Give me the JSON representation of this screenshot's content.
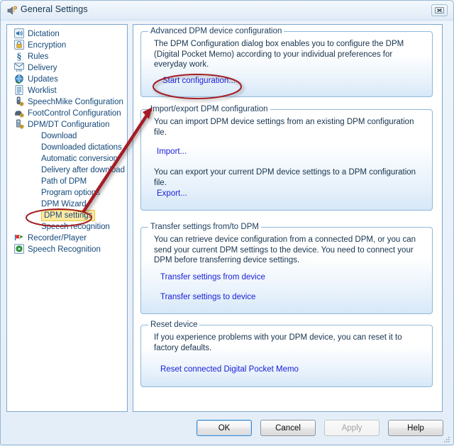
{
  "window": {
    "title": "General Settings",
    "title_icon": "speaker-settings-icon",
    "close_label": "Close"
  },
  "sidebar": {
    "items": [
      {
        "label": "Dictation",
        "icon": "dictation-icon",
        "level": 0
      },
      {
        "label": "Encryption",
        "icon": "lock-icon",
        "level": 0
      },
      {
        "label": "Rules",
        "icon": "section-sign-icon",
        "level": 0
      },
      {
        "label": "Delivery",
        "icon": "ftp-envelope-icon",
        "level": 0
      },
      {
        "label": "Updates",
        "icon": "globe-refresh-icon",
        "level": 0
      },
      {
        "label": "Worklist",
        "icon": "list-icon",
        "level": 0
      },
      {
        "label": "SpeechMike Configuration",
        "icon": "speechmike-icon",
        "level": 0
      },
      {
        "label": "FootControl Configuration",
        "icon": "footcontrol-icon",
        "level": 0
      },
      {
        "label": "DPM/DT Configuration",
        "icon": "dpm-device-icon",
        "level": 0
      },
      {
        "label": "Download",
        "icon": "",
        "level": 1
      },
      {
        "label": "Downloaded dictations",
        "icon": "",
        "level": 1
      },
      {
        "label": "Automatic conversion",
        "icon": "",
        "level": 1
      },
      {
        "label": "Delivery after download",
        "icon": "",
        "level": 1
      },
      {
        "label": "Path of DPM",
        "icon": "",
        "level": 1
      },
      {
        "label": "Program options",
        "icon": "",
        "level": 1
      },
      {
        "label": "DPM Wizard",
        "icon": "",
        "level": 1
      },
      {
        "label": "DPM settings",
        "icon": "",
        "level": 1,
        "highlighted": true
      },
      {
        "label": "Speech recognition",
        "icon": "",
        "level": 1
      },
      {
        "label": "Recorder/Player",
        "icon": "play-flag-icon",
        "level": 0
      },
      {
        "label": "Speech Recognition",
        "icon": "green-gear-icon",
        "level": 0
      }
    ]
  },
  "main": {
    "groups": [
      {
        "title": "Advanced DPM device configuration",
        "text": "The DPM Configuration dialog box enables you to configure the DPM (Digital Pocket Memo) according to your individual preferences for everyday work.",
        "links": [
          "Start configuration..."
        ]
      },
      {
        "title": "Import/export DPM configuration",
        "text": "You can import DPM device settings from an existing DPM configuration file.",
        "text2": "You can export your current DPM device settings to a DPM configuration file.",
        "links": [
          "Import...",
          "Export..."
        ]
      },
      {
        "title": "Transfer settings from/to DPM",
        "text": "You can retrieve device configuration from a connected DPM, or you can send your current DPM settings to the device. You need to connect your DPM before transferring device settings.",
        "links": [
          "Transfer settings from device",
          "Transfer settings to device"
        ]
      },
      {
        "title": "Reset device",
        "text": "If you experience problems with your DPM device, you can reset it to factory defaults.",
        "links": [
          "Reset connected Digital Pocket Memo"
        ]
      }
    ]
  },
  "footer": {
    "ok": "OK",
    "cancel": "Cancel",
    "apply": "Apply",
    "help": "Help"
  },
  "colors": {
    "annotation_red": "#a51f25",
    "highlight_yellow": "#ffe9a0",
    "link_blue": "#1a20d8",
    "panel_border": "#7ea7cc"
  }
}
